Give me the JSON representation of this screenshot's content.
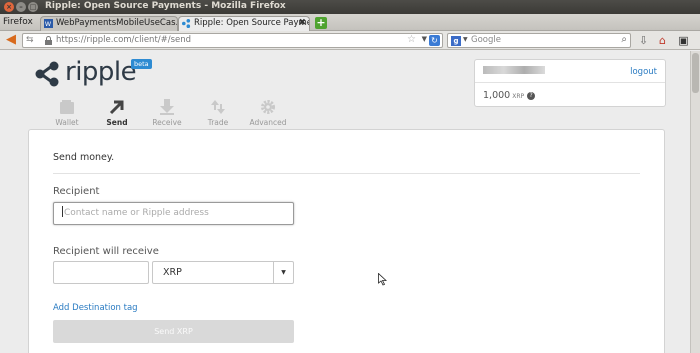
{
  "window": {
    "title": "Ripple: Open Source Payments - Mozilla Firefox"
  },
  "browser": {
    "menu_label": "Firefox",
    "tabs": [
      {
        "label": "WebPaymentsMobileUseCas...",
        "icon": "w3c-icon",
        "active": false
      },
      {
        "label": "Ripple: Open Source Payments",
        "icon": "ripple-icon",
        "active": true
      }
    ],
    "url": "https://ripple.com/client/#/send",
    "search_placeholder": "Google"
  },
  "app": {
    "brand": "ripple",
    "badge": "beta",
    "nav": [
      {
        "label": "Wallet",
        "icon": "wallet-icon",
        "active": false
      },
      {
        "label": "Send",
        "icon": "send-arrow-icon",
        "active": true
      },
      {
        "label": "Receive",
        "icon": "receive-icon",
        "active": false
      },
      {
        "label": "Trade",
        "icon": "trade-icon",
        "active": false
      },
      {
        "label": "Advanced",
        "icon": "gear-icon",
        "active": false
      }
    ],
    "account": {
      "logout_label": "logout",
      "balance": "1,000",
      "unit": "XRP",
      "help_glyph": "?"
    }
  },
  "send_form": {
    "heading": "Send money.",
    "recipient_label": "Recipient",
    "recipient_placeholder": "Contact name or Ripple address",
    "amount_label": "Recipient will receive",
    "amount_value": "",
    "currency": "XRP",
    "destination_tag_link": "Add Destination tag",
    "submit_label": "Send XRP"
  }
}
